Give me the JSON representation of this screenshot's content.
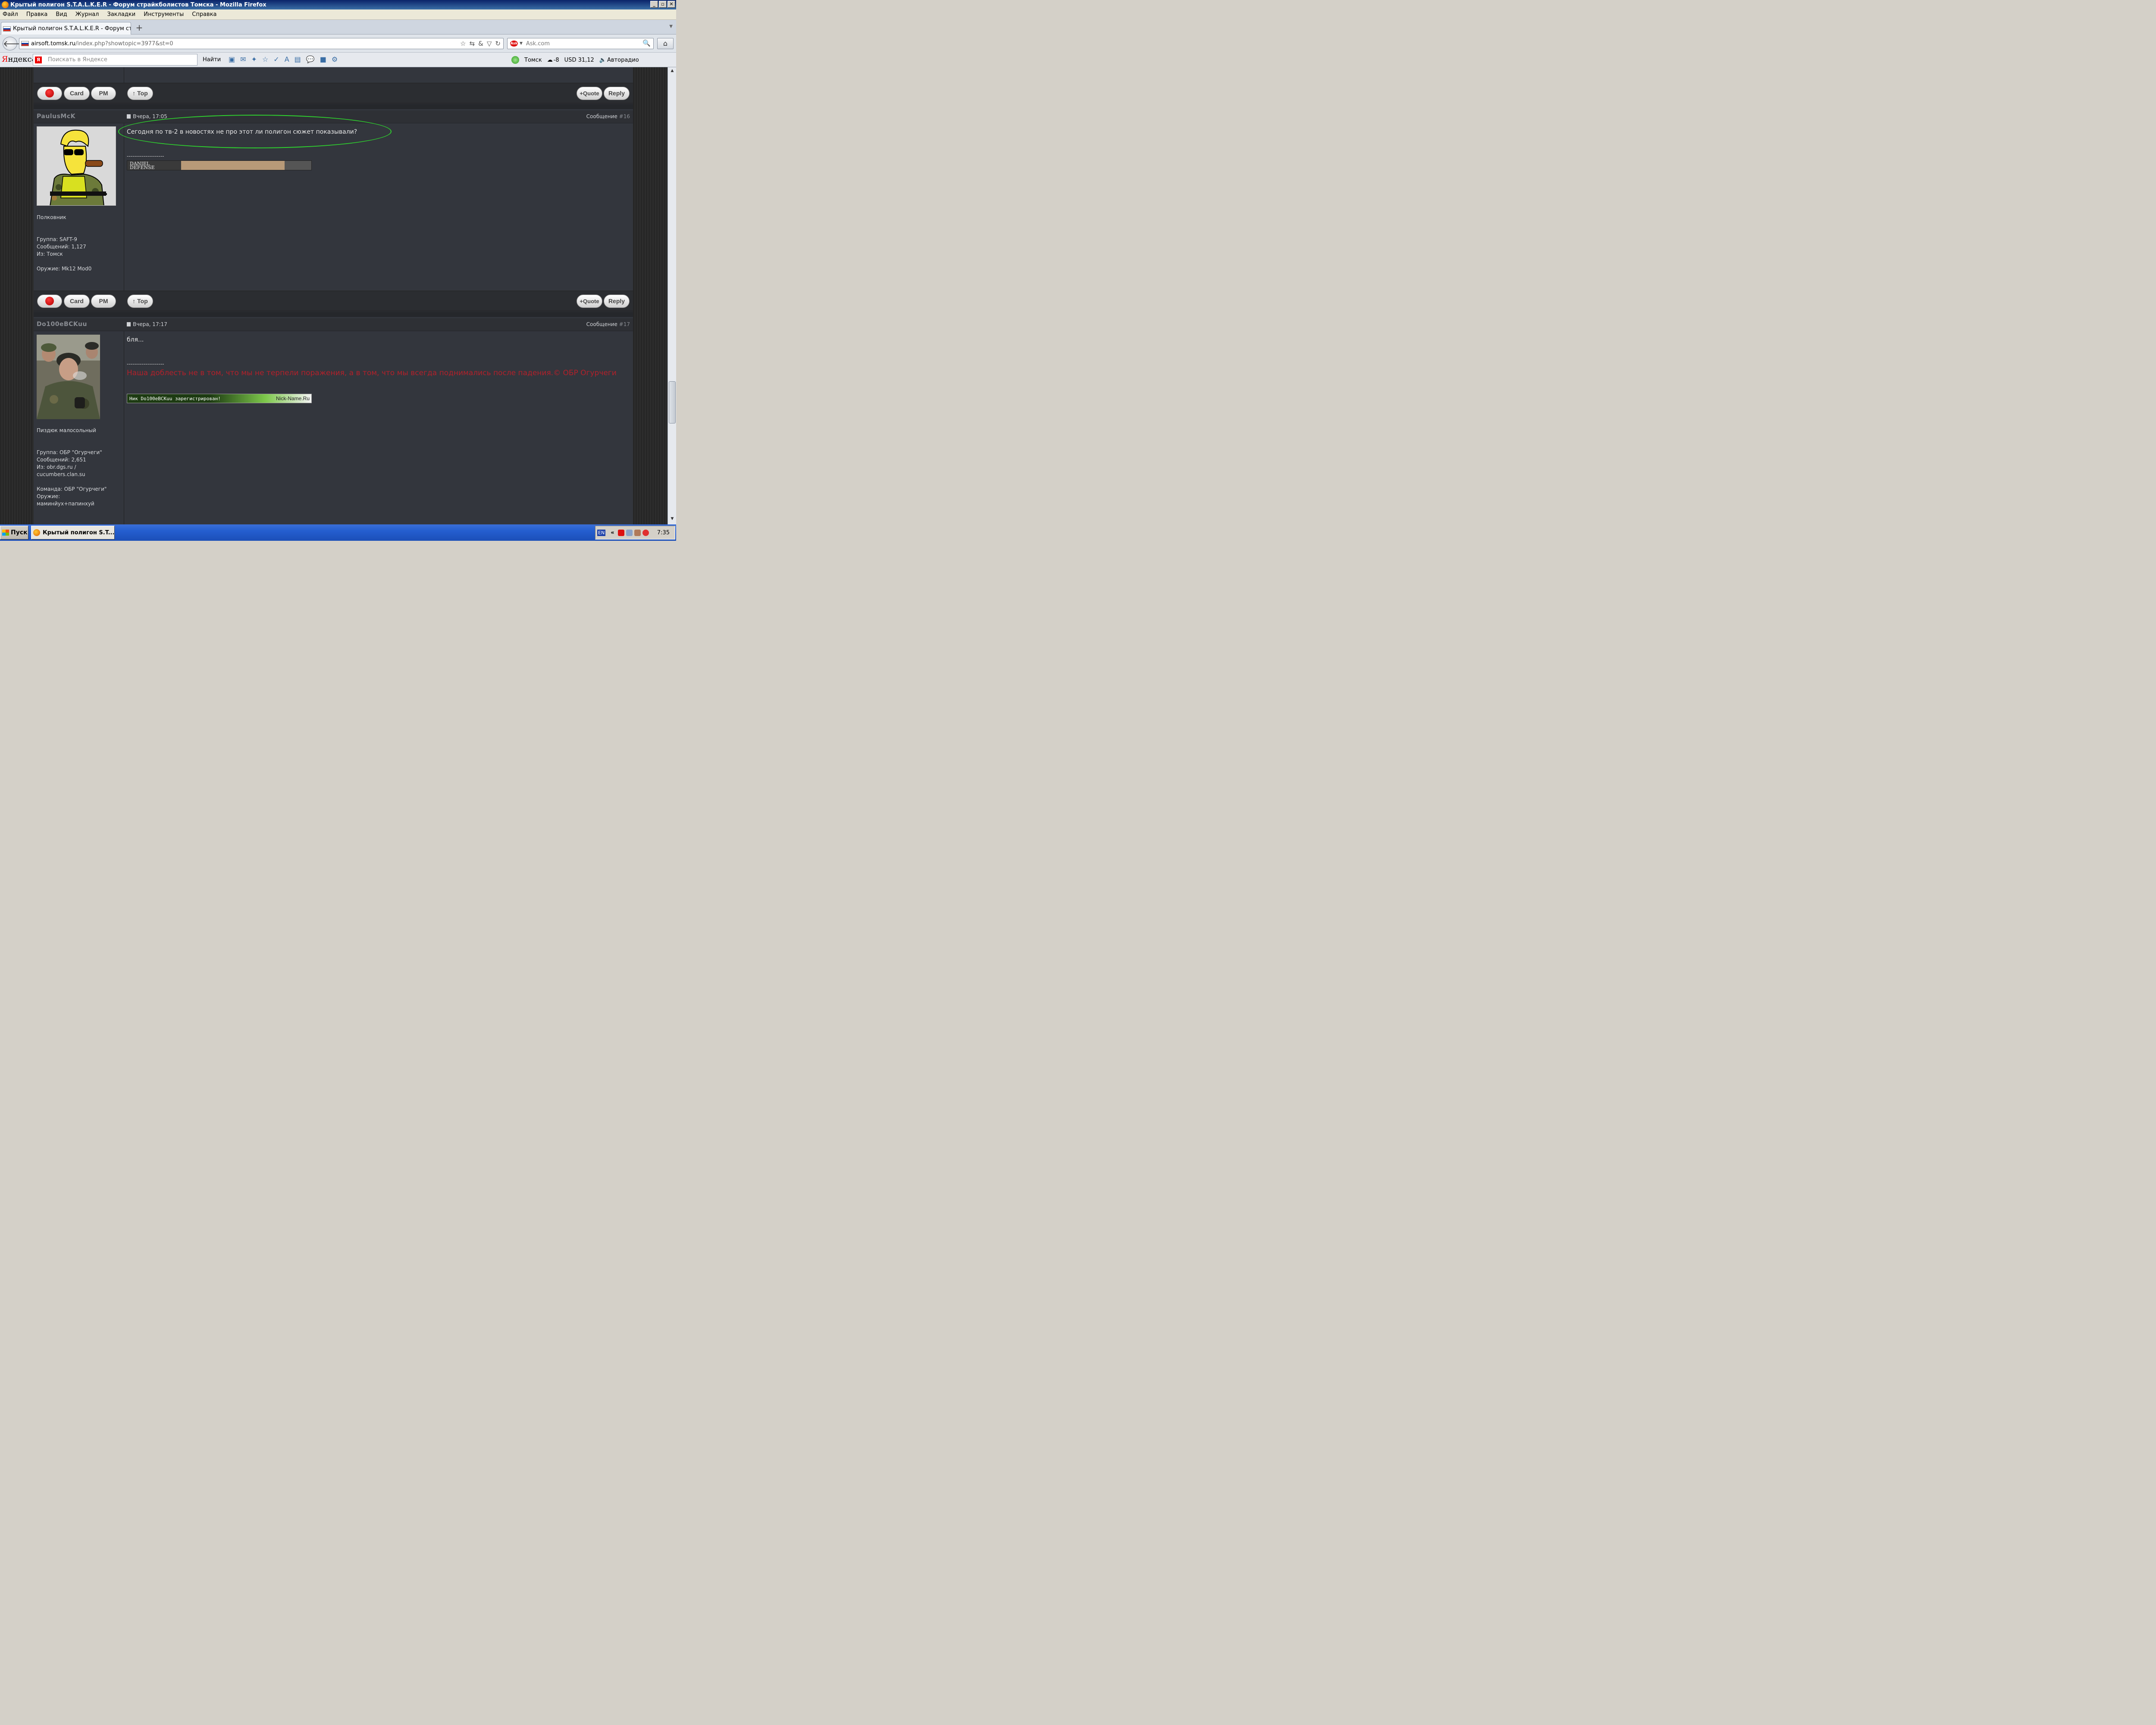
{
  "window": {
    "title": "Крытый полигон S.T.A.L.K.E.R - Форум страйкболистов Томска - Mozilla Firefox"
  },
  "menu": [
    "Файл",
    "Правка",
    "Вид",
    "Журнал",
    "Закладки",
    "Инструменты",
    "Справка"
  ],
  "tab": {
    "label": "Крытый полигон S.T.A.L.K.E.R - Форум ст...",
    "new_tab": "+"
  },
  "nav": {
    "url_host": "airsoft.tomsk.ru",
    "url_path": "/index.php?showtopic=3977&st=0",
    "search_placeholder": "Ask.com",
    "search_logo": "Ask"
  },
  "yandex": {
    "logo_prefix": "Я",
    "logo_rest": "ндекс",
    "badge": "Я",
    "placeholder": "Поискать в Яндексе",
    "find_label": "Найти",
    "city": "Томск",
    "weather": "-8",
    "currency": "USD 31,12",
    "radio": "Авторадио"
  },
  "buttons": {
    "card": "Card",
    "pm": "PM",
    "top": "Top",
    "quote": "+Quote",
    "reply": "Reply"
  },
  "posts": [
    {
      "author": "PaulusMcK",
      "date": "Вчера, 17:05",
      "msg_label": "Сообщение",
      "msg_num": "#16",
      "rank": "Полковник",
      "group": "Группа: SAFT-9",
      "posts": "Сообщений: 1,127",
      "from": "Из: Томск",
      "weapon": "Оружие: Mk12 Mod0",
      "text": "Сегодня по тв-2 в новостях не про этот ли полигон сюжет показывали?",
      "sig_sep": "--------------------",
      "banner_text_1": "DANIEL",
      "banner_text_2": "DEFENSE"
    },
    {
      "author": "Do100eBCKuu",
      "date": "Вчера, 17:17",
      "msg_label": "Сообщение",
      "msg_num": "#17",
      "rank": "Пиздюк малосольный",
      "group": "Группа: ОБР \"Огурчеги\"",
      "posts": "Сообщений: 2,651",
      "from_1": "Из: obr.dgs.ru /",
      "from_2": "cucumbers.clan.su",
      "team": "Команда: ОБР \"Огурчеги\"",
      "weapon_1": "Оружие:",
      "weapon_2": "маминйух+папинхуй",
      "text": "бля...",
      "sig_sep": "--------------------",
      "quote": "Наша доблесть не в том, что мы не терпели поражения, а в том, что мы всегда поднимались после падения.© ОБР Огурчеги",
      "banner_left": "Ник Do100eBCKuu зарегистрирован!",
      "banner_right": "Nick-Name.Ru"
    }
  ],
  "taskbar": {
    "start": "Пуск",
    "item": "Крытый полигон S.T....",
    "lang": "EN",
    "chevron": "«",
    "clock": "7:35"
  },
  "colors": {
    "highlight": "#2ed12e",
    "quote_red": "#b3202a",
    "forum_bg": "#33363d"
  }
}
